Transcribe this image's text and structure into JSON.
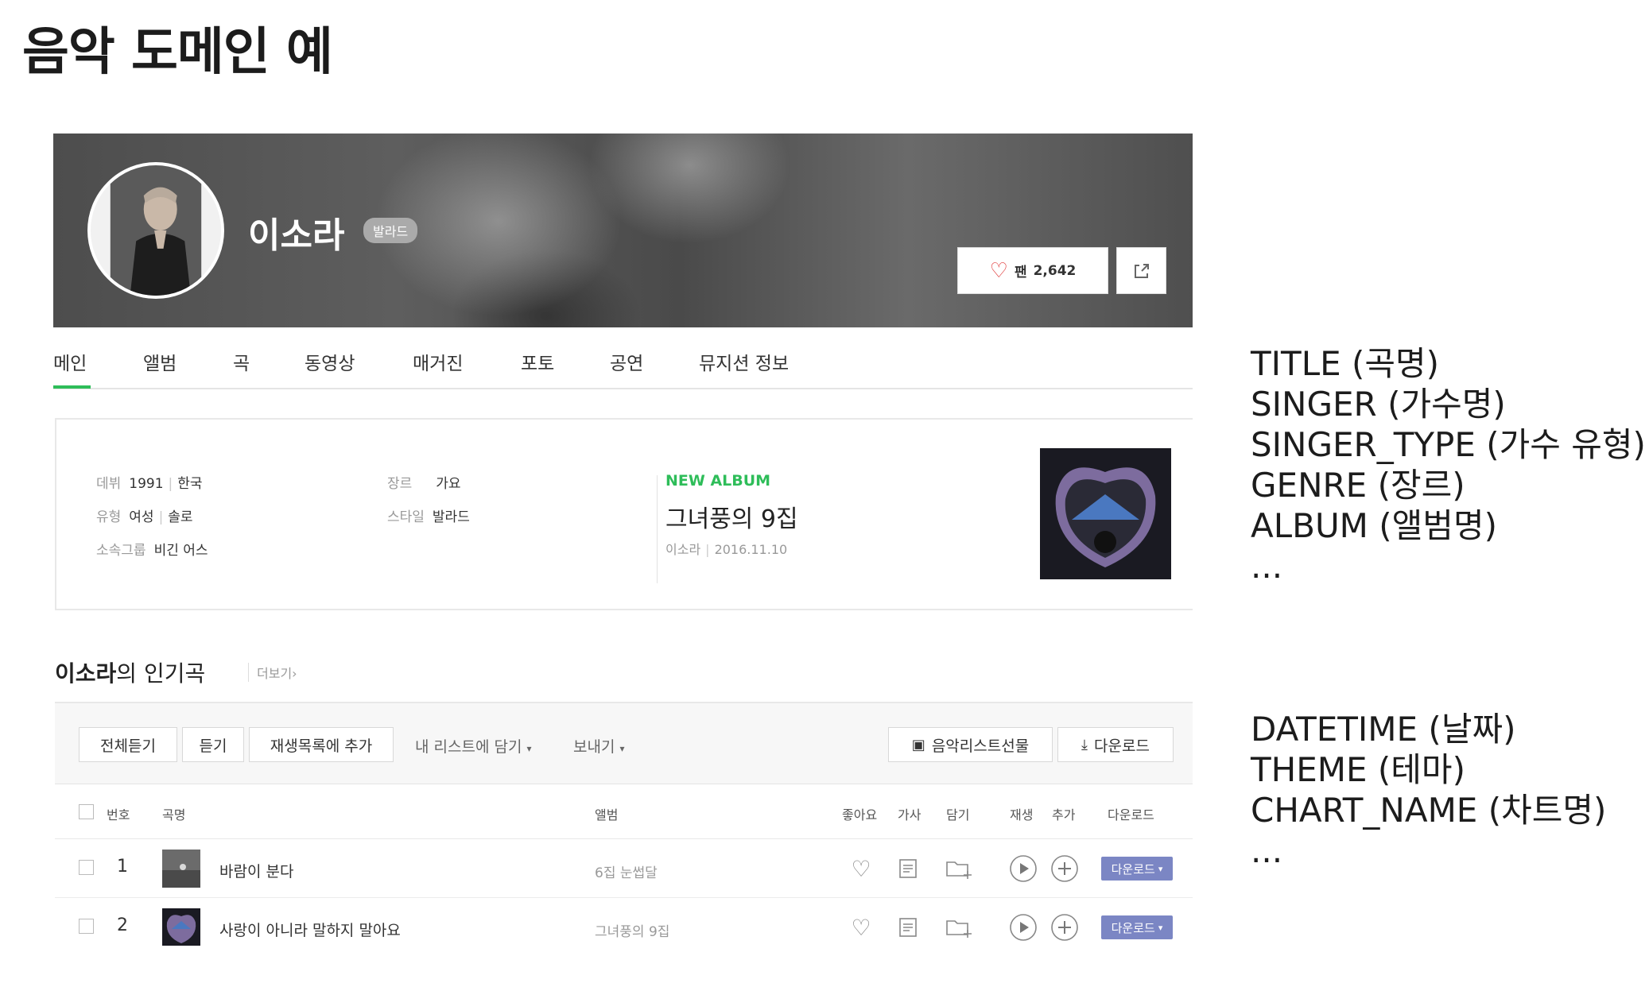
{
  "slide": {
    "title": "음악 도메인 예"
  },
  "artist": {
    "name": "이소라",
    "genre_badge": "발라드",
    "fan_label": "팬",
    "fan_count": "2,642"
  },
  "tabs": [
    "메인",
    "앨범",
    "곡",
    "동영상",
    "매거진",
    "포토",
    "공연",
    "뮤지션 정보"
  ],
  "info": {
    "debut_label": "데뷔",
    "debut_year": "1991",
    "debut_country": "한국",
    "type_label": "유형",
    "type_gender": "여성",
    "type_kind": "솔로",
    "agency_label": "소속그룹",
    "agency": "비긴 어스",
    "genre_label": "장르",
    "genre": "가요",
    "style_label": "스타일",
    "style": "발라드"
  },
  "new_album": {
    "tag": "NEW ALBUM",
    "title": "그녀풍의 9집",
    "artist": "이소라",
    "date": "2016.11.10"
  },
  "popular": {
    "artist": "이소라",
    "suffix": "의 인기곡",
    "more": "더보기"
  },
  "toolbar": {
    "play_all": "전체듣기",
    "play": "듣기",
    "add_playlist": "재생목록에 추가",
    "add_mylist": "내 리스트에 담기",
    "send": "보내기",
    "gift": "음악리스트선물",
    "download": "다운로드"
  },
  "table": {
    "headers": {
      "number": "번호",
      "title": "곡명",
      "album": "앨범",
      "like": "좋아요",
      "lyrics": "가사",
      "save": "담기",
      "play": "재생",
      "add": "추가",
      "download": "다운로드"
    },
    "rows": [
      {
        "number": "1",
        "title": "바람이 분다",
        "album": "6집 눈썹달",
        "download": "다운로드"
      },
      {
        "number": "2",
        "title": "사랑이 아니라 말하지 말아요",
        "album": "그녀풍의 9집",
        "download": "다운로드"
      }
    ]
  },
  "notes_top": [
    "TITLE (곡명)",
    "SINGER (가수명)",
    "SINGER_TYPE (가수 유형)",
    "GENRE (장르)",
    "ALBUM (앨범명)",
    "..."
  ],
  "notes_bottom": [
    "DATETIME (날짜)",
    "THEME (테마)",
    "CHART_NAME (차트명)",
    "..."
  ],
  "colors": {
    "accent_green": "#2ebd59",
    "download_purple": "#7b86c4",
    "heart_red": "#e03b3b"
  }
}
